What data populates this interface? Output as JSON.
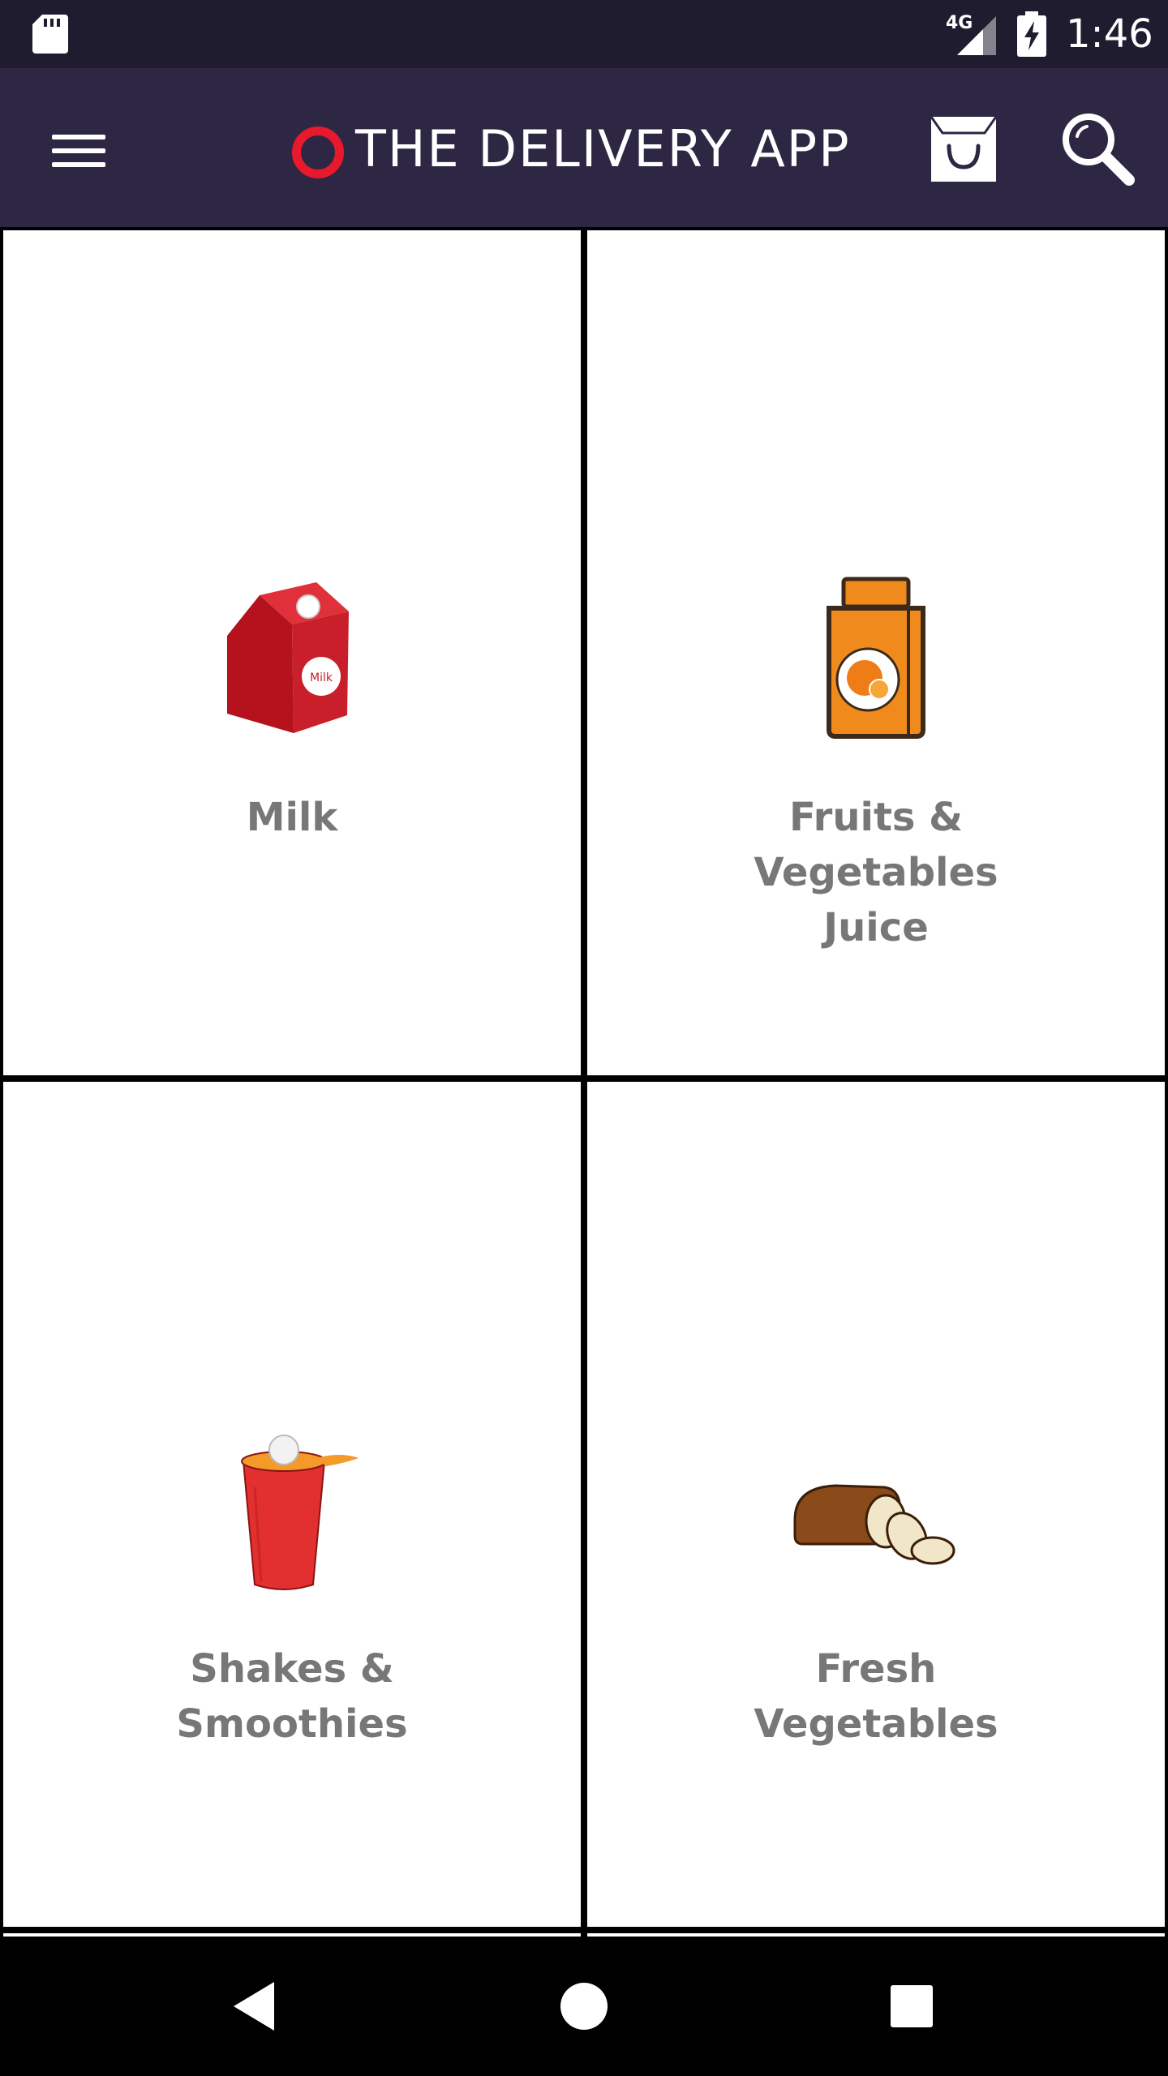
{
  "status_bar": {
    "network": "4G",
    "time": "1:46",
    "icons": [
      "sd-card-icon",
      "signal-icon",
      "battery-charging-icon"
    ]
  },
  "app_bar": {
    "title": "THE DELIVERY APP",
    "logo_color": "#e8192c",
    "background": "#2d2744",
    "icons": [
      "menu-icon",
      "shopping-bag-icon",
      "search-icon"
    ]
  },
  "categories": [
    {
      "label": "Milk",
      "icon": "milk-carton-icon"
    },
    {
      "label": "Fruits & Vegetables Juice",
      "icon": "juice-carton-icon"
    },
    {
      "label": "Shakes & Smoothies",
      "icon": "smoothie-cup-icon"
    },
    {
      "label": "Fresh Vegetables",
      "icon": "bread-loaf-icon"
    }
  ],
  "nav_bar": {
    "icons": [
      "back-icon",
      "home-icon",
      "recents-icon"
    ]
  }
}
